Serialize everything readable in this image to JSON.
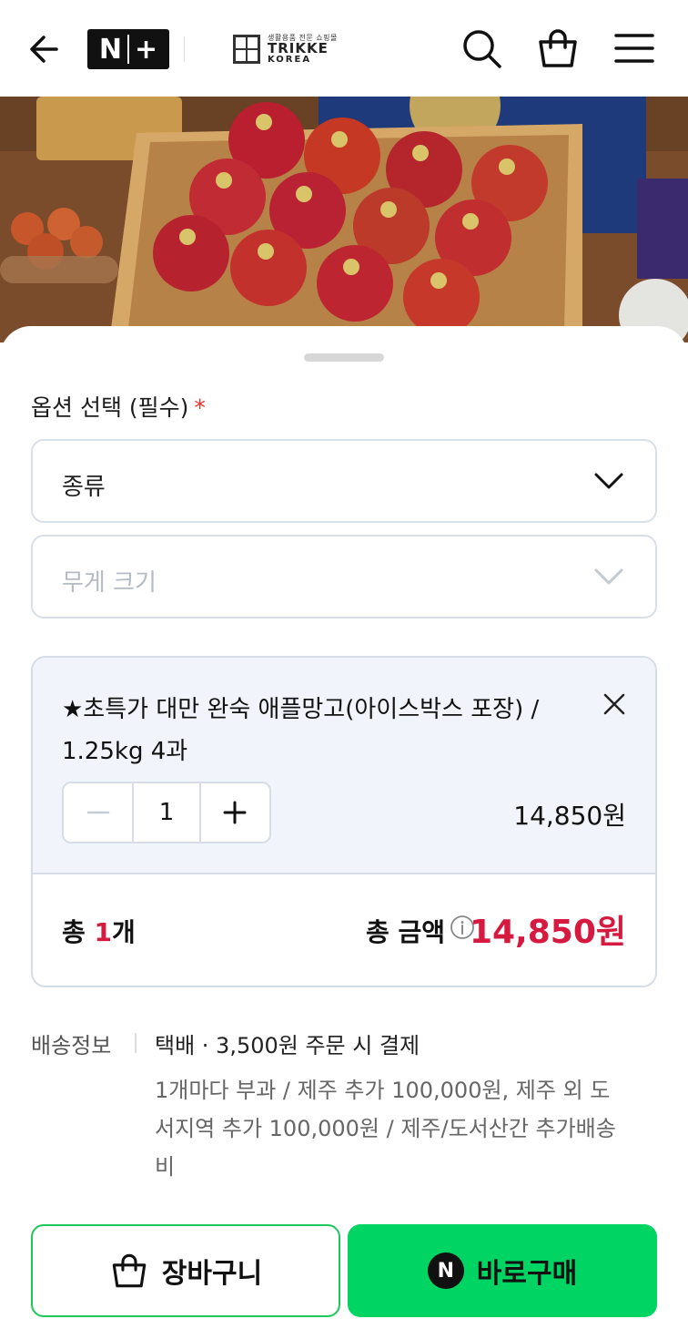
{
  "header": {
    "brand_badge": "N+",
    "brand_sub": "생활용품 전문 쇼핑몰",
    "brand_name": "TRIKKE",
    "brand_name2": "KOREA"
  },
  "options": {
    "title": "옵션 선택 (필수)",
    "required_mark": "*",
    "select1_label": "종류",
    "select2_placeholder": "무게 크기"
  },
  "selected_item": {
    "name": "★초특가 대만 완숙 애플망고(아이스박스 포장) / 1.25kg 4과",
    "quantity": "1",
    "price": "14,850원"
  },
  "totals": {
    "count_prefix": "총 ",
    "count_value": "1",
    "count_suffix": "개",
    "amount_label": "총 금액",
    "amount": "14,850원"
  },
  "shipping": {
    "label": "배송정보",
    "main": "택배 · 3,500원 주문 시 결제",
    "note": "1개마다 부과 / 제주 추가 100,000원, 제주 외 도서지역 추가 100,000원 / 제주/도서산간 추가배송비"
  },
  "buttons": {
    "cart": "장바구니",
    "buy": "바로구매",
    "npay_badge": "N"
  },
  "colors": {
    "accent_red": "#d6193f",
    "buy_green": "#00d563",
    "required_red": "#e4352b"
  }
}
